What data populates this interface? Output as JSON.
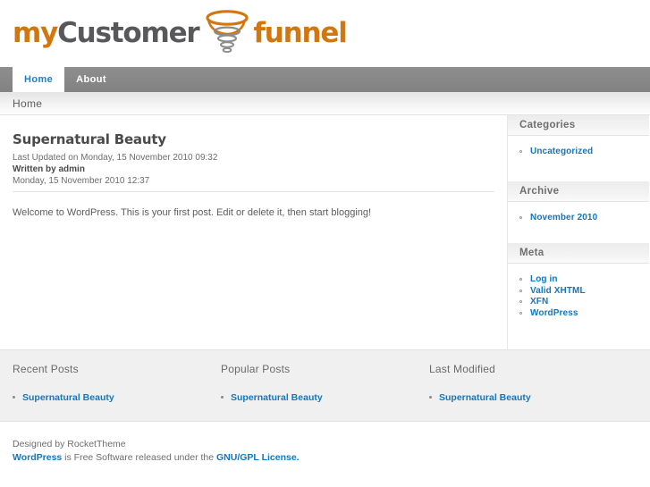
{
  "site": {
    "logo": {
      "part1": "my",
      "part2": "Customer",
      "part3": "funnel",
      "mark_name": "funnel-vortex-icon",
      "orange": "#d2760f",
      "gray": "#58585a"
    }
  },
  "nav": {
    "items": [
      {
        "label": "Home",
        "active": true
      },
      {
        "label": "About",
        "active": false
      }
    ]
  },
  "breadcrumb": {
    "text": "Home"
  },
  "article": {
    "title": "Supernatural Beauty",
    "last_updated": "Last Updated on Monday, 15 November 2010 09:32",
    "written_by": "Written by admin",
    "date": "Monday, 15 November 2010 12:37",
    "body": "Welcome to WordPress. This is your first post. Edit or delete it, then start blogging!"
  },
  "sidebar": {
    "modules": [
      {
        "title": "Categories",
        "links": [
          "Uncategorized"
        ]
      },
      {
        "title": "Archive",
        "links": [
          "November 2010"
        ]
      },
      {
        "title": "Meta",
        "links": [
          "Log in",
          "Valid XHTML",
          "XFN",
          "WordPress"
        ]
      }
    ]
  },
  "bottom": {
    "columns": [
      {
        "title": "Recent Posts",
        "links": [
          "Supernatural Beauty"
        ]
      },
      {
        "title": "Popular Posts",
        "links": [
          "Supernatural Beauty"
        ]
      },
      {
        "title": "Last Modified",
        "links": [
          "Supernatural Beauty"
        ]
      }
    ]
  },
  "footer": {
    "designed_by": "Designed by RocketTheme",
    "wordpress": "WordPress",
    "license_mid": " is Free Software released under the ",
    "license_link": "GNU/GPL License."
  },
  "colors": {
    "link": "#1277bf",
    "nav_bg": "#868686",
    "accent_orange": "#d2760f",
    "bottom_bg": "#f0f0f0"
  }
}
